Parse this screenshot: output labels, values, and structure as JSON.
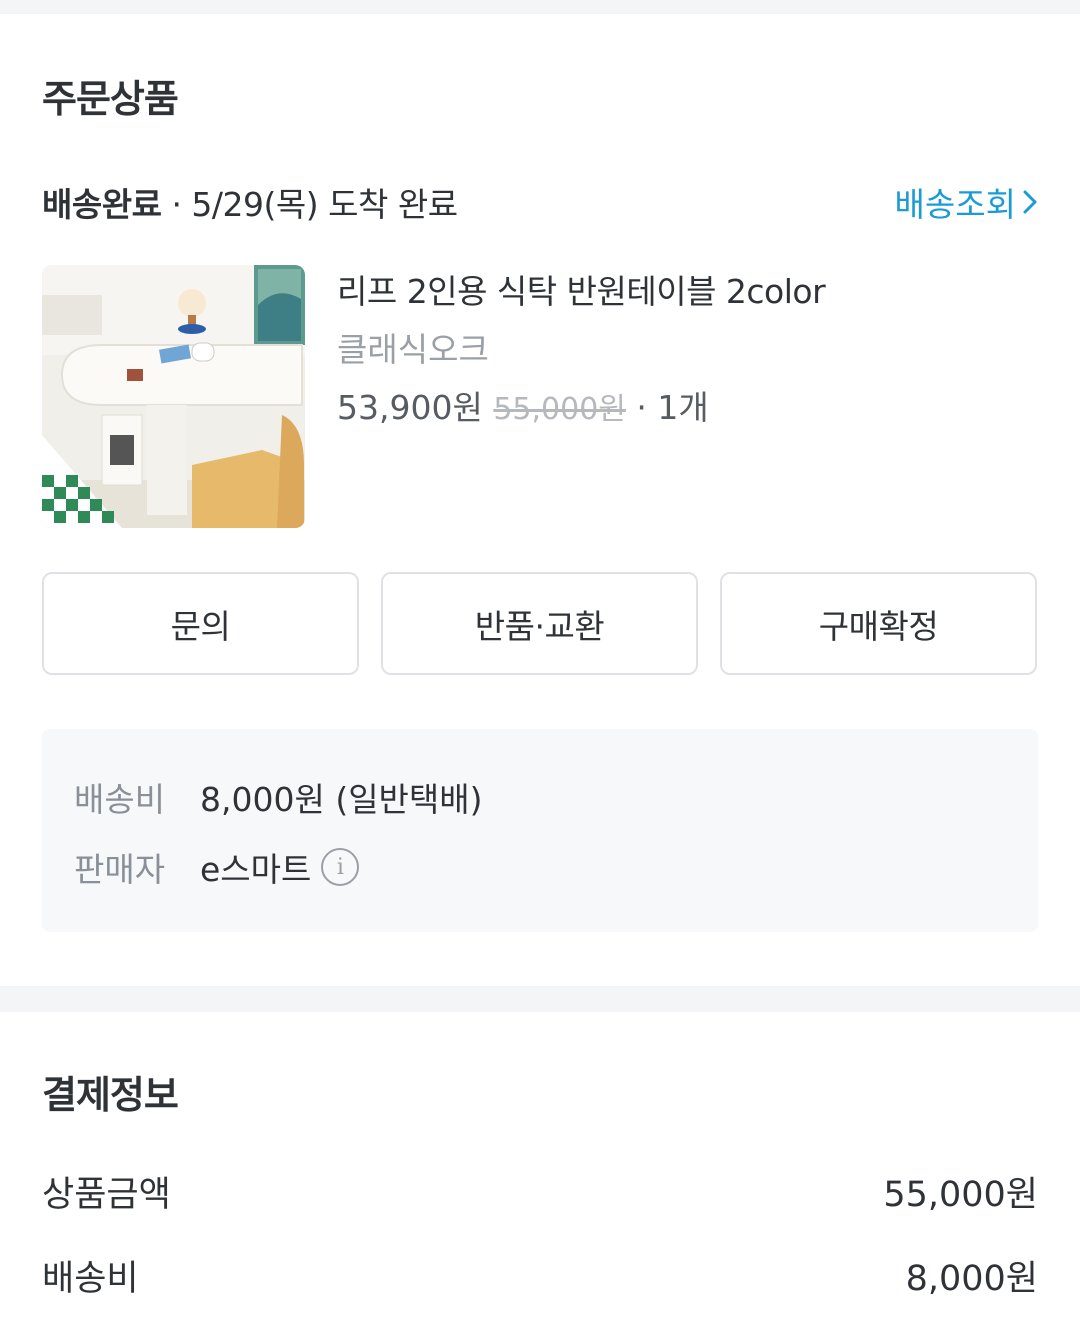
{
  "order_items": {
    "title": "주문상품",
    "status_label": "배송완료",
    "status_detail": " · 5/29(목) 도착 완료",
    "track_label": "배송조회",
    "product": {
      "name": "리프 2인용 식탁 반원테이블 2color",
      "seller": "클래식오크",
      "price": "53,900원",
      "original_price": "55,000원",
      "quantity": " · 1개"
    },
    "buttons": {
      "inquiry": "문의",
      "return_exchange": "반품·교환",
      "confirm_purchase": "구매확정"
    },
    "info": {
      "shipping_label": "배송비",
      "shipping_value": "8,000원 (일반택배)",
      "seller_label": "판매자",
      "seller_value": "e스마트"
    }
  },
  "payment": {
    "title": "결제정보",
    "rows": [
      {
        "label": "상품금액",
        "value": "55,000원"
      },
      {
        "label": "배송비",
        "value": "8,000원"
      }
    ]
  },
  "colors": {
    "accent": "#1a9bd7",
    "divider": "#f4f5f7",
    "info_bg": "#f7f8fa"
  }
}
